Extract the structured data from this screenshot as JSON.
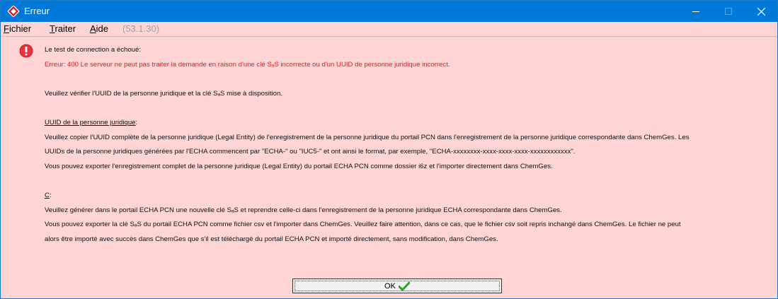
{
  "window": {
    "title": "Erreur"
  },
  "menu": {
    "fichier_first": "F",
    "fichier_rest": "ichier",
    "traiter_first": "T",
    "traiter_rest": "raiter",
    "aide_first": "A",
    "aide_rest": "ide",
    "version": "(53.1.30)"
  },
  "message": {
    "line1": "Le test de connection a échoué:",
    "error": "Erreur: 400 Le serveur ne peut pas traiter la demande en raison d'une clé SₐS incorrecte ou d'un UUID de personne juridique incorrect.",
    "verify": "Veuillez vérifier l'UUID de la personne juridique et la clé SₐS mise à disposition.",
    "uuid_heading": "UUID de la personne juridique",
    "uuid_heading_suffix": ":",
    "uuid_p1": "Veuillez copier l'UUID complète de la personne juridique (Legal Entity) de l'enregistrement de la personne juridique du portail PCN dans l'enregistrement de la personne juridique correspondante dans ChemGes. Les",
    "uuid_p2": "UUIDs de la personne juridiques générées par l'ECHA commencent par \"ECHA-\" ou \"IUC5-\" et ont ainsi le format, par exemple, \"ECHA-xxxxxxxx-xxxx-xxxx-xxxx-xxxxxxxxxxxx\".",
    "uuid_p3": "Vous pouvez exporter l'enregistrement complet de la personne juridique (Legal Entity) du portail ECHA PCN comme dossier i6z et l'importer directement dans ChemGes.",
    "c_heading": "C",
    "c_heading_suffix": ":",
    "c_p1": "Veuillez générer dans le portail ECHA PCN une nouvelle clé SₐS et reprendre celle-ci dans l'enregistrement de la personne juridique ECHA correspondante dans ChemGes.",
    "c_p2": "Vous pouvez exporter la clé SₐS du portail ECHA PCN comme fichier csv et l'importer dans ChemGes. Veuillez faire attention, dans ce cas, que le fichier csv soit repris inchangé dans ChemGes. Le fichier ne peut",
    "c_p3": "alors être importé avec succès dans ChemGes que s'il est téléchargé du portail ECHA PCN et importé directement, sans modification, dans ChemGes."
  },
  "ok_button": {
    "label": "OK"
  },
  "colors": {
    "titlebar": "#0078d7",
    "background": "#ffd4d4",
    "error_text": "#e21d1d",
    "check": "#2e9e2e"
  }
}
